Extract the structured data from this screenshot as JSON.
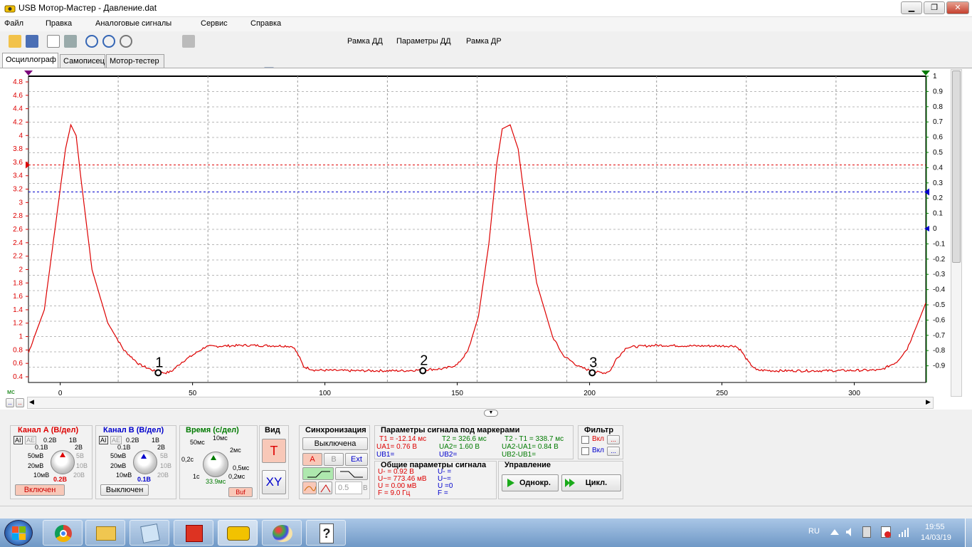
{
  "window": {
    "title": "USB Мотор-Мастер - Давление.dat",
    "minimize": "▁",
    "restore": "❐",
    "close": "✕"
  },
  "menu": [
    "Файл",
    "Правка",
    "Аналоговые сигналы",
    "Сервис",
    "Справка"
  ],
  "toolbar": {
    "buttons": [
      "Рамка ДД",
      "Параметры ДД",
      "Рамка ДР"
    ]
  },
  "tabs": [
    "Осциллограф",
    "Самописец",
    "Мотор-тестер"
  ],
  "scope": {
    "left_axis": [
      "4.8",
      "4.6",
      "4.4",
      "4.2",
      "4",
      "3.8",
      "3.6",
      "3.4",
      "3.2",
      "3",
      "2.8",
      "2.6",
      "2.4",
      "2.2",
      "2",
      "1.8",
      "1.6",
      "1.4",
      "1.2",
      "1",
      "0.8",
      "0.6",
      "0.4"
    ],
    "right_axis": [
      "1",
      "0.9",
      "0.8",
      "0.7",
      "0.6",
      "0.5",
      "0.4",
      "0.3",
      "0.2",
      "0.1",
      "0",
      "-0.1",
      "-0.2",
      "-0.3",
      "-0.4",
      "-0.5",
      "-0.6",
      "-0.7",
      "-0.8",
      "-0.9"
    ],
    "x_ticks": [
      "0",
      "50",
      "100",
      "150",
      "200",
      "250",
      "300"
    ],
    "x_unit": "мс",
    "markers": [
      "1",
      "2",
      "3"
    ],
    "colors": {
      "channel_a": "#dd0000",
      "channel_b": "#0000cc",
      "grid": "#9a9a9a"
    }
  },
  "chart_data": {
    "type": "line",
    "xlabel": "мс",
    "ylabel": "",
    "xlim": [
      -12,
      327
    ],
    "ylim": [
      0.35,
      4.9
    ],
    "series": [
      {
        "x": [
          -12,
          -6,
          -2,
          2,
          4,
          6,
          8,
          12,
          18,
          24,
          30,
          36,
          38,
          40,
          42,
          46,
          55,
          70,
          85,
          88,
          90,
          92,
          96,
          110,
          130,
          145,
          150,
          154,
          158,
          162,
          165,
          167,
          170,
          173,
          176,
          180,
          186,
          190,
          196,
          202,
          206,
          208,
          210,
          214,
          225,
          240,
          255,
          257,
          260,
          263,
          270,
          290,
          310,
          316,
          320,
          324,
          327
        ],
        "y": [
          0.76,
          1.4,
          2.6,
          3.8,
          4.16,
          4.0,
          3.3,
          2.0,
          1.2,
          0.8,
          0.58,
          0.48,
          0.46,
          0.46,
          0.48,
          0.62,
          0.85,
          0.87,
          0.86,
          0.85,
          0.72,
          0.55,
          0.5,
          0.49,
          0.49,
          0.52,
          0.58,
          0.78,
          1.3,
          2.4,
          3.6,
          4.1,
          4.16,
          3.8,
          2.9,
          1.8,
          1.0,
          0.72,
          0.55,
          0.47,
          0.46,
          0.5,
          0.66,
          0.84,
          0.87,
          0.86,
          0.86,
          0.8,
          0.62,
          0.5,
          0.49,
          0.49,
          0.5,
          0.62,
          0.82,
          1.2,
          1.5
        ]
      }
    ]
  },
  "channel_a": {
    "title": "Канал А (В/дел)",
    "ranges": [
      "0.2В",
      "1В",
      "0.1В",
      "2В",
      "50мВ",
      "5В",
      "20мВ",
      "10В",
      "10мВ",
      "20В"
    ],
    "value": "0.2В",
    "button": "Включен",
    "ai": "AI",
    "ae": "AE"
  },
  "channel_b": {
    "title": "Канал В (В/дел)",
    "ranges": [
      "0.2В",
      "1В",
      "0.1В",
      "2В",
      "50мВ",
      "5В",
      "20мВ",
      "10В",
      "10мВ",
      "20В"
    ],
    "value": "0.1В",
    "button": "Выключен",
    "ai": "AI",
    "ae": "AE"
  },
  "time": {
    "title": "Время (с/дел)",
    "ranges": [
      "10мс",
      "50мс",
      "2мс",
      "0,2с",
      "1с",
      "0,5мс",
      "0,2мс"
    ],
    "value": "33.9мс",
    "buf": "Buf"
  },
  "view": {
    "title": "Вид",
    "t": "T",
    "xy": "XY"
  },
  "sync": {
    "title": "Синхронизация",
    "state": "Выключена",
    "a": "A",
    "b": "B",
    "ext": "Ext",
    "level": "0.5",
    "unit": "В"
  },
  "params": {
    "title": "Параметры сигнала под маркерами",
    "c1": [
      "T1 = -12.14 мс",
      "UA1= 0.76 В",
      "UB1="
    ],
    "c2": [
      "T2 = 326.6 мс",
      "UA2= 1.60 В",
      "UB2="
    ],
    "c3": [
      "T2 - T1 = 338.7 мс",
      "UA2-UA1= 0.84 В",
      "UB2-UB1="
    ]
  },
  "general": {
    "title": "Общие параметры сигнала",
    "a": [
      "U- = 0.92 В",
      "U~= 773.46 мВ",
      "U  = 0.00 мВ",
      "F  = 9.0 Гц"
    ],
    "b": [
      "U- =",
      "U~=",
      "U  =0",
      "F  ="
    ]
  },
  "control": {
    "title": "Управление",
    "single": "Однокр.",
    "cycle": "Цикл."
  },
  "filter": {
    "title": "Фильтр",
    "on": "Вкл",
    "more": "..."
  },
  "taskbar": {
    "lang": "RU",
    "time": "19:55",
    "date": "14/03/19"
  }
}
